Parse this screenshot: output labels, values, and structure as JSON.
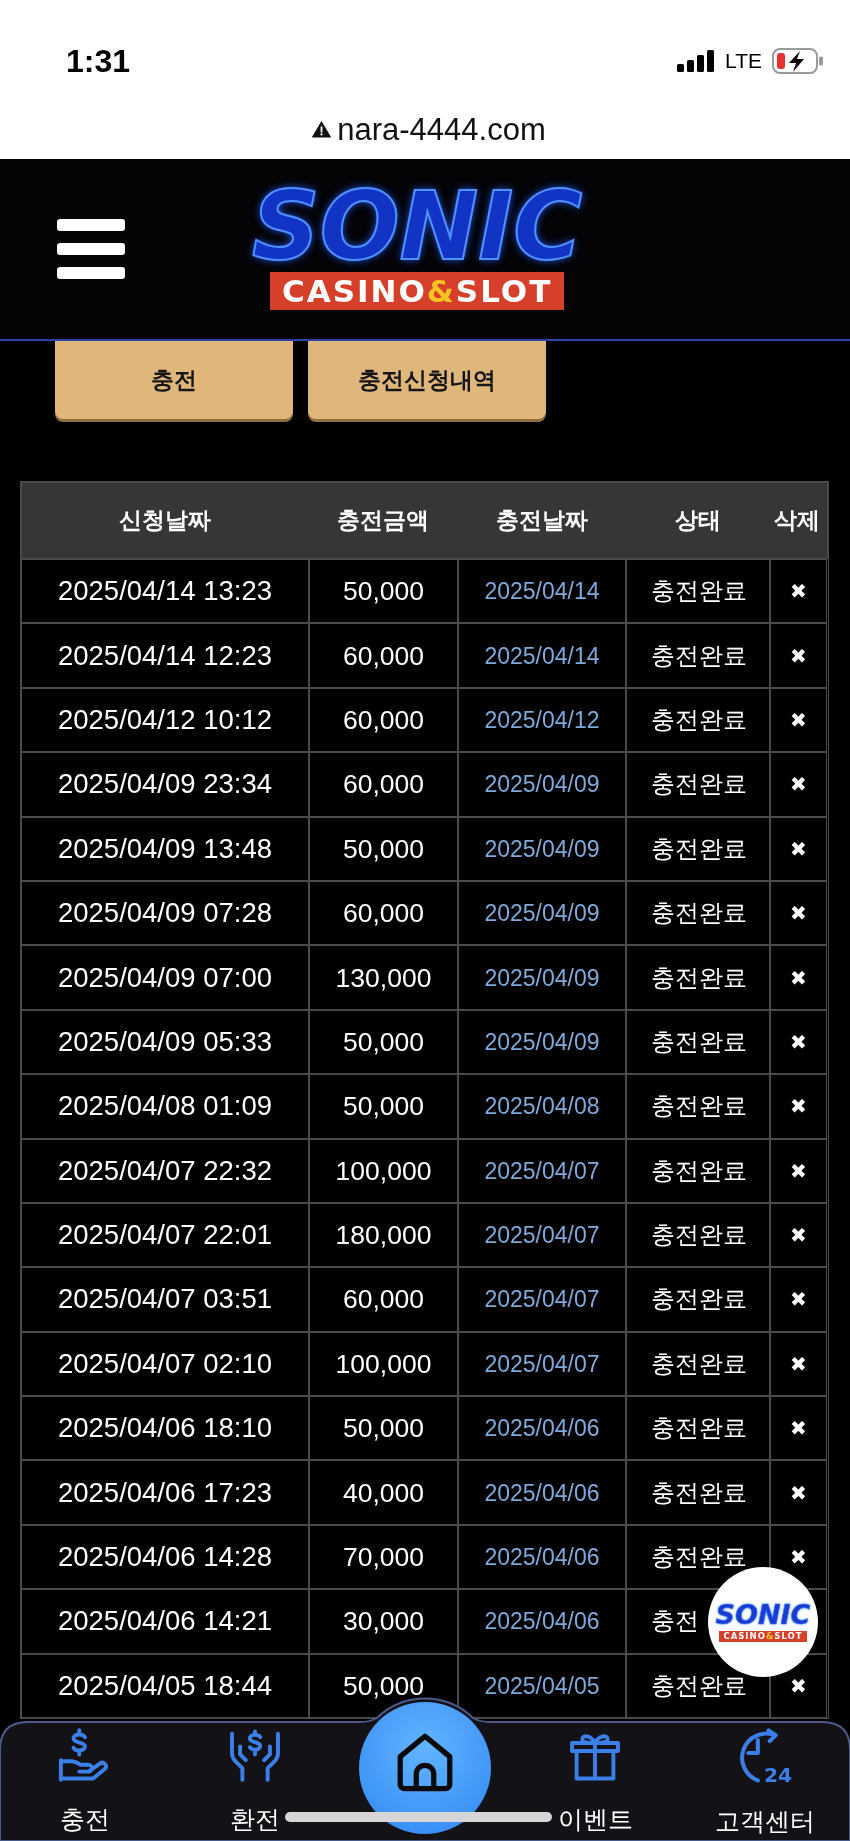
{
  "status_bar": {
    "time": "1:31",
    "network": "LTE"
  },
  "address_bar": {
    "url": "nara-4444.com"
  },
  "header": {
    "logo": {
      "title": "SONIC",
      "banner": [
        "CASINO",
        "&",
        "SLOT"
      ]
    }
  },
  "actions": [
    {
      "label": "충전"
    },
    {
      "label": "충전신청내역"
    }
  ],
  "table": {
    "columns": [
      "신청날짜",
      "충전금액",
      "충전날짜",
      "상태",
      "삭제"
    ],
    "rows": [
      {
        "requested": "2025/04/14 13:23",
        "amount": "50,000",
        "charged": "2025/04/14",
        "status": "충전완료",
        "delete": "✖"
      },
      {
        "requested": "2025/04/14 12:23",
        "amount": "60,000",
        "charged": "2025/04/14",
        "status": "충전완료",
        "delete": "✖"
      },
      {
        "requested": "2025/04/12 10:12",
        "amount": "60,000",
        "charged": "2025/04/12",
        "status": "충전완료",
        "delete": "✖"
      },
      {
        "requested": "2025/04/09 23:34",
        "amount": "60,000",
        "charged": "2025/04/09",
        "status": "충전완료",
        "delete": "✖"
      },
      {
        "requested": "2025/04/09 13:48",
        "amount": "50,000",
        "charged": "2025/04/09",
        "status": "충전완료",
        "delete": "✖"
      },
      {
        "requested": "2025/04/09 07:28",
        "amount": "60,000",
        "charged": "2025/04/09",
        "status": "충전완료",
        "delete": "✖"
      },
      {
        "requested": "2025/04/09 07:00",
        "amount": "130,000",
        "charged": "2025/04/09",
        "status": "충전완료",
        "delete": "✖"
      },
      {
        "requested": "2025/04/09 05:33",
        "amount": "50,000",
        "charged": "2025/04/09",
        "status": "충전완료",
        "delete": "✖"
      },
      {
        "requested": "2025/04/08 01:09",
        "amount": "50,000",
        "charged": "2025/04/08",
        "status": "충전완료",
        "delete": "✖"
      },
      {
        "requested": "2025/04/07 22:32",
        "amount": "100,000",
        "charged": "2025/04/07",
        "status": "충전완료",
        "delete": "✖"
      },
      {
        "requested": "2025/04/07 22:01",
        "amount": "180,000",
        "charged": "2025/04/07",
        "status": "충전완료",
        "delete": "✖"
      },
      {
        "requested": "2025/04/07 03:51",
        "amount": "60,000",
        "charged": "2025/04/07",
        "status": "충전완료",
        "delete": "✖"
      },
      {
        "requested": "2025/04/07 02:10",
        "amount": "100,000",
        "charged": "2025/04/07",
        "status": "충전완료",
        "delete": "✖"
      },
      {
        "requested": "2025/04/06 18:10",
        "amount": "50,000",
        "charged": "2025/04/06",
        "status": "충전완료",
        "delete": "✖"
      },
      {
        "requested": "2025/04/06 17:23",
        "amount": "40,000",
        "charged": "2025/04/06",
        "status": "충전완료",
        "delete": "✖"
      },
      {
        "requested": "2025/04/06 14:28",
        "amount": "70,000",
        "charged": "2025/04/06",
        "status": "충전완료",
        "delete": "✖"
      },
      {
        "requested": "2025/04/06 14:21",
        "amount": "30,000",
        "charged": "2025/04/06",
        "status": "충전"
      },
      {
        "requested": "2025/04/05 18:44",
        "amount": "50,000",
        "charged": "2025/04/05",
        "status": "충전완료",
        "delete": "✖"
      }
    ]
  },
  "floating_logo": {
    "title": "SONIC",
    "banner": [
      "CASINO",
      "&",
      "SLOT"
    ]
  },
  "bottom_nav": [
    {
      "kind": "tab",
      "label": "충전"
    },
    {
      "kind": "tab",
      "label": "환전"
    },
    {
      "kind": "center"
    },
    {
      "kind": "tab",
      "label": "이벤트"
    },
    {
      "kind": "tab",
      "label": "고객센터",
      "icon_text": "24"
    }
  ]
}
